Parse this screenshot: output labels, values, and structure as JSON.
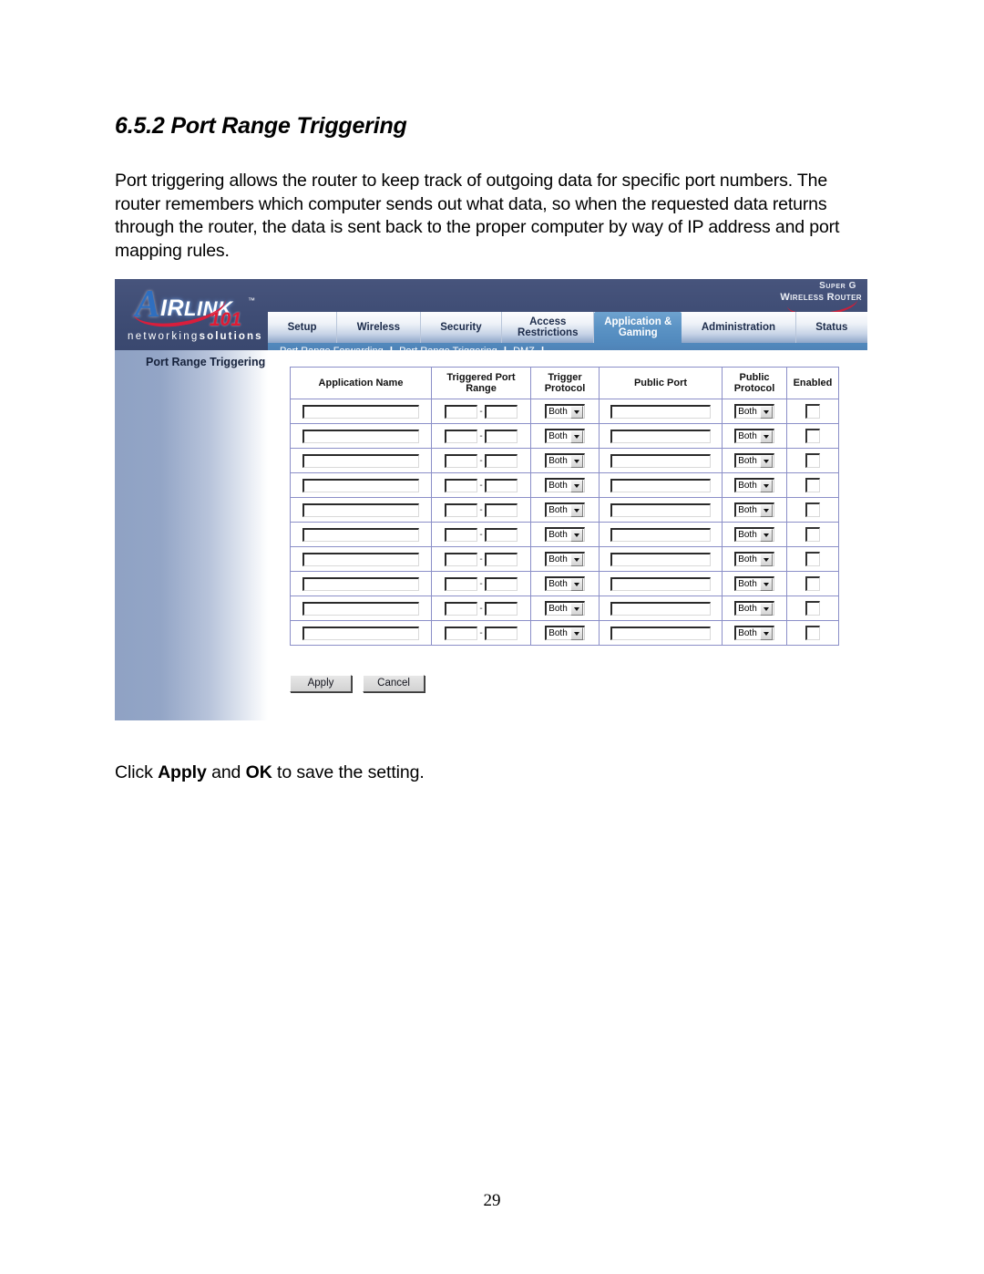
{
  "document": {
    "heading": "6.5.2 Port Range Triggering",
    "paragraph": "Port triggering allows the router to keep track of outgoing data for specific port numbers. The router remembers which computer sends out what data, so when the requested data returns through the router, the data is sent back to the proper computer by way of IP address and port mapping rules.",
    "caption": {
      "before": "Click ",
      "bold1": "Apply",
      "middle": " and ",
      "bold2": "OK",
      "after": " to save the setting."
    },
    "page_number": "29"
  },
  "router_ui": {
    "brand": {
      "logo_letter": "A",
      "logo_word_cap": "IR",
      "logo_word_rest": "L",
      "logo_word_ink": "INK",
      "logo_tm": "™",
      "logo_model": "101",
      "tagline_thin": "networking",
      "tagline_bold": "solutions",
      "product_line1": "Super G",
      "product_line1_sup": "®",
      "product_line2": "Wireless Router"
    },
    "tabs": [
      {
        "label": "Setup",
        "active": false
      },
      {
        "label": "Wireless",
        "active": false
      },
      {
        "label": "Security",
        "active": false
      },
      {
        "label": "Access Restrictions",
        "active": false
      },
      {
        "label": "Application & Gaming",
        "active": true
      },
      {
        "label": "Administration",
        "active": false
      },
      {
        "label": "Status",
        "active": false
      }
    ],
    "subnav": [
      {
        "label": "Port Range Forwarding"
      },
      {
        "label": "Port Range Triggering"
      },
      {
        "label": "DMZ"
      }
    ],
    "subnav_separator": "|",
    "panel_title": "Port Range Triggering",
    "table": {
      "headers": [
        "Application Name",
        "Triggered Port Range",
        "Trigger Protocol",
        "Public Port",
        "Public Protocol",
        "Enabled"
      ],
      "range_separator": "-",
      "row_count": 10,
      "rows": [
        {
          "application_name": "",
          "triggered_port_start": "",
          "triggered_port_end": "",
          "trigger_protocol": "Both",
          "public_port": "",
          "public_protocol": "Both",
          "enabled": false
        },
        {
          "application_name": "",
          "triggered_port_start": "",
          "triggered_port_end": "",
          "trigger_protocol": "Both",
          "public_port": "",
          "public_protocol": "Both",
          "enabled": false
        },
        {
          "application_name": "",
          "triggered_port_start": "",
          "triggered_port_end": "",
          "trigger_protocol": "Both",
          "public_port": "",
          "public_protocol": "Both",
          "enabled": false
        },
        {
          "application_name": "",
          "triggered_port_start": "",
          "triggered_port_end": "",
          "trigger_protocol": "Both",
          "public_port": "",
          "public_protocol": "Both",
          "enabled": false
        },
        {
          "application_name": "",
          "triggered_port_start": "",
          "triggered_port_end": "",
          "trigger_protocol": "Both",
          "public_port": "",
          "public_protocol": "Both",
          "enabled": false
        },
        {
          "application_name": "",
          "triggered_port_start": "",
          "triggered_port_end": "",
          "trigger_protocol": "Both",
          "public_port": "",
          "public_protocol": "Both",
          "enabled": false
        },
        {
          "application_name": "",
          "triggered_port_start": "",
          "triggered_port_end": "",
          "trigger_protocol": "Both",
          "public_port": "",
          "public_protocol": "Both",
          "enabled": false
        },
        {
          "application_name": "",
          "triggered_port_start": "",
          "triggered_port_end": "",
          "trigger_protocol": "Both",
          "public_port": "",
          "public_protocol": "Both",
          "enabled": false
        },
        {
          "application_name": "",
          "triggered_port_start": "",
          "triggered_port_end": "",
          "trigger_protocol": "Both",
          "public_port": "",
          "public_protocol": "Both",
          "enabled": false
        },
        {
          "application_name": "",
          "triggered_port_start": "",
          "triggered_port_end": "",
          "trigger_protocol": "Both",
          "public_port": "",
          "public_protocol": "Both",
          "enabled": false
        }
      ]
    },
    "buttons": {
      "apply": "Apply",
      "cancel": "Cancel"
    },
    "colors": {
      "header_navy": "#3e4c74",
      "active_tab_blue": "#5a92c4",
      "subnav_blue": "#4b7cb0",
      "sidebar_blue": "#8fa2c4",
      "table_border": "#8b8fc8",
      "logo_red": "#e01b34"
    }
  }
}
